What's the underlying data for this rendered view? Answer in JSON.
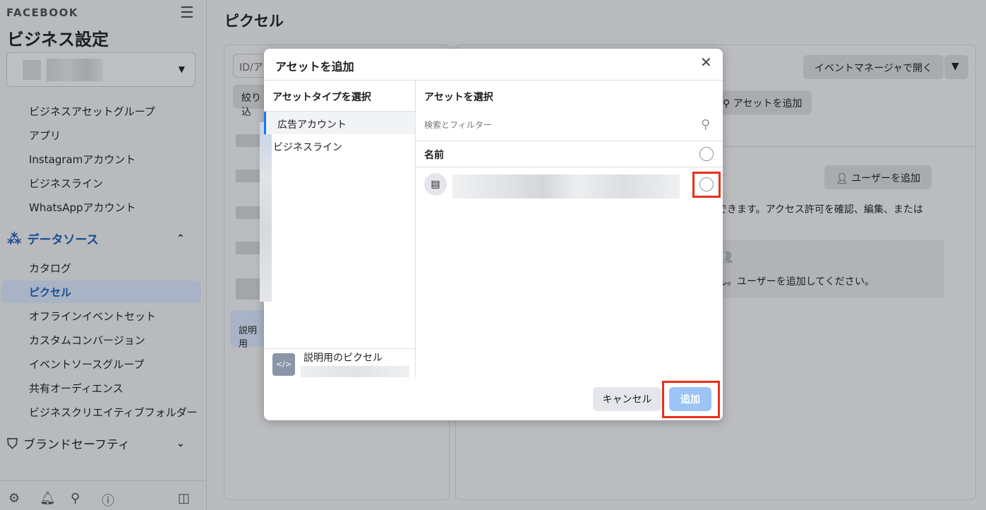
{
  "sidebar": {
    "brand": "FACEBOOK",
    "title": "ビジネス設定",
    "items": [
      {
        "label": "ビジネスアセットグループ"
      },
      {
        "label": "アプリ"
      },
      {
        "label": "Instagramアカウント"
      },
      {
        "label": "ビジネスライン"
      },
      {
        "label": "WhatsAppアカウント"
      }
    ],
    "section_data_sources": "データソース",
    "data_source_items": [
      {
        "label": "カタログ"
      },
      {
        "label": "ピクセル"
      },
      {
        "label": "オフラインイベントセット"
      },
      {
        "label": "カスタムコンバージョン"
      },
      {
        "label": "イベントソースグループ"
      },
      {
        "label": "共有オーディエンス"
      },
      {
        "label": "ビジネスクリエイティブフォルダー"
      }
    ],
    "section_brand_safety": "ブランドセーフティ"
  },
  "main": {
    "title": "ピクセル",
    "left_input_placeholder": "ID/ア",
    "left_filter_label": "絞り込",
    "left_selected_label": "説明用",
    "open_event_manager": "イベントマネージャで開く",
    "add_asset": "アセットを追加",
    "add_user": "ユーザーを追加",
    "info_text": "できます。アクセス許可を確認、編集、または",
    "empty_text": "ん。ユーザーを追加してください。"
  },
  "modal": {
    "title": "アセットを追加",
    "col_type_title": "アセットタイプを選択",
    "col_asset_title": "アセットを選択",
    "asset_types": [
      {
        "label": "広告アカウント"
      },
      {
        "label": "ビジネスライン"
      }
    ],
    "pixel_name": "説明用のピクセル",
    "search_placeholder": "検索とフィルター",
    "name_header": "名前",
    "cancel_label": "キャンセル",
    "add_label": "追加"
  },
  "colors": {
    "accent": "#1877f2",
    "highlight": "#e8301c",
    "add_button_disabled": "#9cc5f5"
  }
}
